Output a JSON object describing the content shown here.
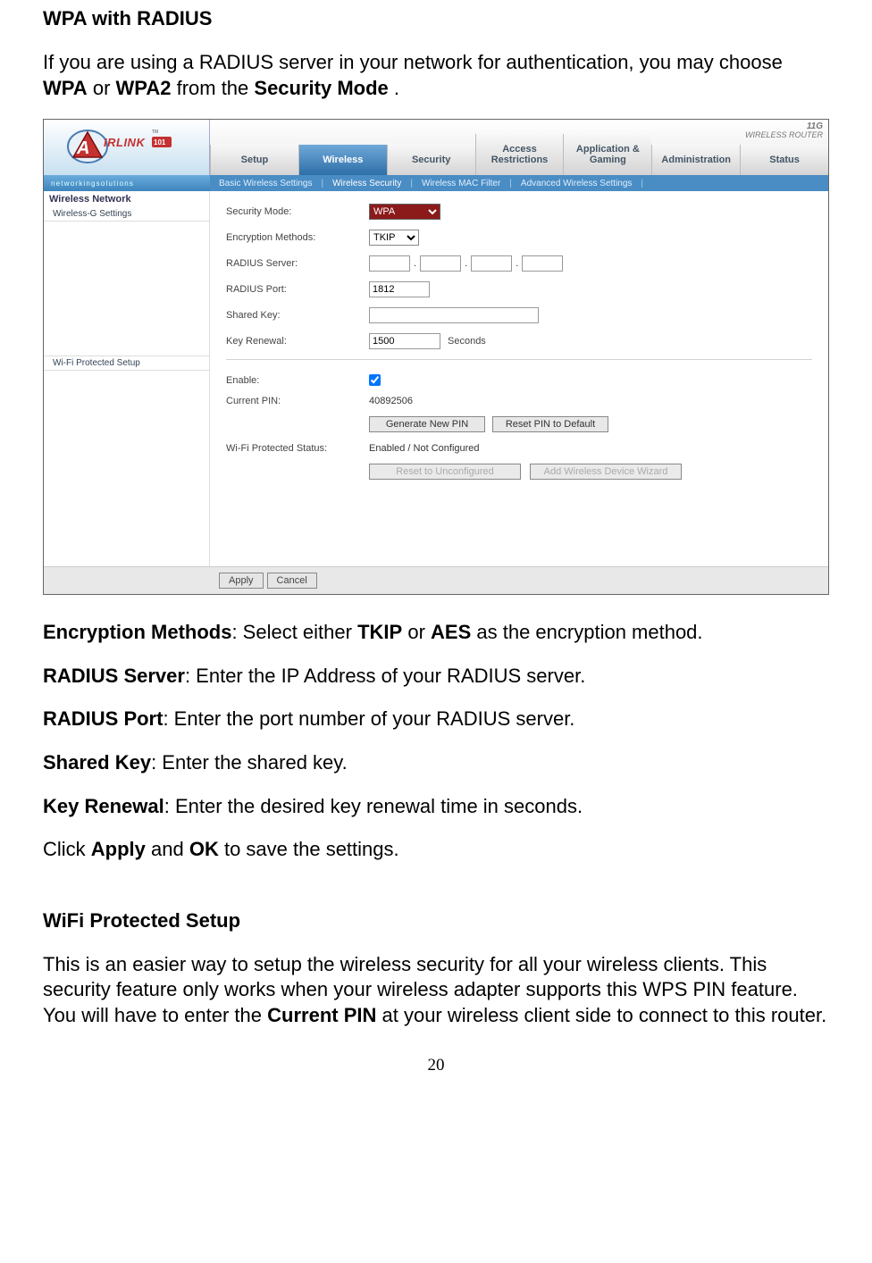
{
  "doc": {
    "heading1": "WPA with RADIUS",
    "intro_a": "If you are using a RADIUS server in your network for authentication, you may choose ",
    "intro_b1": "WPA",
    "intro_b2": " or ",
    "intro_b3": "WPA2",
    "intro_b4": " from the ",
    "intro_b5": "Security Mode",
    "intro_b6": ".",
    "enc_label": "Encryption Methods",
    "enc_text": ": Select either ",
    "enc_v1": "TKIP",
    "enc_mid": " or ",
    "enc_v2": "AES",
    "enc_end": " as the encryption method.",
    "rad_srv_label": "RADIUS Server",
    "rad_srv_text": ": Enter the IP Address of your RADIUS server.",
    "rad_port_label": "RADIUS Port",
    "rad_port_text": ": Enter the port number of your RADIUS server.",
    "shared_label": "Shared Key",
    "shared_text": ": Enter the shared key.",
    "renew_label": "Key Renewal",
    "renew_text": ": Enter the desired key renewal time in seconds.",
    "apply_a": "Click ",
    "apply_b": "Apply",
    "apply_c": " and ",
    "apply_d": "OK",
    "apply_e": " to save the settings.",
    "heading2": "WiFi Protected Setup",
    "wps_a": "This is an easier way to setup the wireless security for all your wireless clients. This security feature only works when your wireless adapter supports this WPS PIN feature. You will have to enter the ",
    "wps_b": "Current PIN",
    "wps_c": " at your wireless client side to connect to this router.",
    "page_number": "20"
  },
  "ui": {
    "logo_brand": "AIRLINK",
    "logo_sub": "101",
    "badge_top": "11G",
    "badge_bottom": "WIRELESS ROUTER",
    "tagline": "networkingsolutions",
    "tabs": [
      "Setup",
      "Wireless",
      "Security",
      "Access Restrictions",
      "Application & Gaming",
      "Administration",
      "Status"
    ],
    "active_tab_index": 1,
    "subtabs": [
      "Basic Wireless Settings",
      "Wireless Security",
      "Wireless MAC Filter",
      "Advanced Wireless Settings"
    ],
    "active_subtab_index": 1,
    "sidebar": {
      "heading": "Wireless Network",
      "item1": "Wireless-G Settings",
      "heading2": "Wi-Fi Protected Setup"
    },
    "form": {
      "security_mode_label": "Security Mode:",
      "security_mode_value": "WPA",
      "encryption_label": "Encryption Methods:",
      "encryption_value": "TKIP",
      "radius_server_label": "RADIUS Server:",
      "radius_octets": [
        "",
        "",
        "",
        ""
      ],
      "radius_port_label": "RADIUS Port:",
      "radius_port_value": "1812",
      "shared_key_label": "Shared Key:",
      "shared_key_value": "",
      "key_renewal_label": "Key Renewal:",
      "key_renewal_value": "1500",
      "seconds_label": "Seconds",
      "enable_label": "Enable:",
      "enable_checked": true,
      "current_pin_label": "Current PIN:",
      "current_pin_value": "40892506",
      "gen_pin_btn": "Generate New PIN",
      "reset_pin_btn": "Reset PIN to Default",
      "wps_status_label": "Wi-Fi Protected Status:",
      "wps_status_value": "Enabled / Not Configured",
      "reset_unconfig_btn": "Reset to Unconfigured",
      "add_wizard_btn": "Add Wireless Device Wizard",
      "apply_btn": "Apply",
      "cancel_btn": "Cancel"
    }
  }
}
